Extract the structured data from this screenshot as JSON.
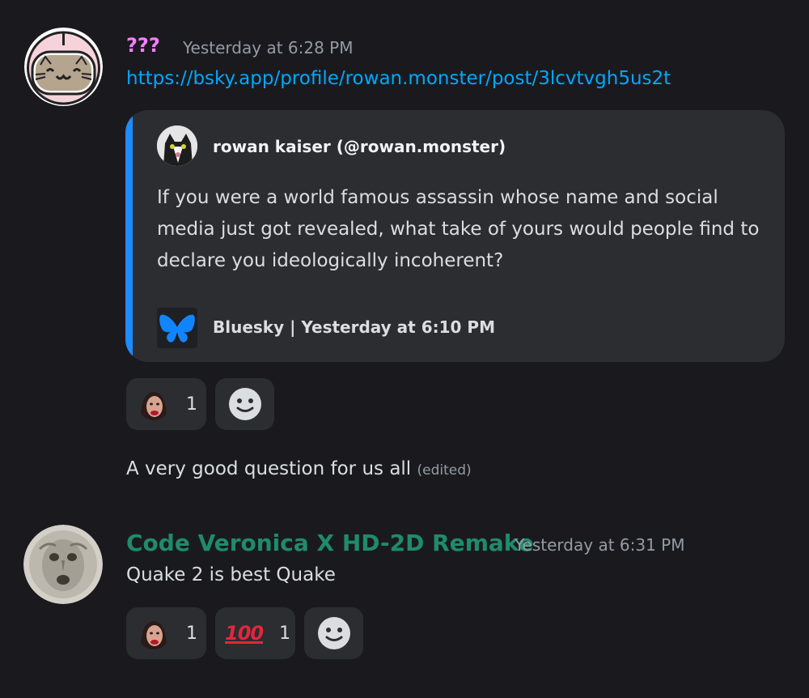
{
  "messages": [
    {
      "username": "???",
      "username_color": "#f47fff",
      "timestamp": "Yesterday at 6:28 PM",
      "avatar_icon": "cat-astronaut-avatar",
      "link": "https://bsky.app/profile/rowan.monster/post/3lcvtvgh5us2t",
      "embed": {
        "author": "rowan kaiser (@rowan.monster)",
        "description": "If you were a world famous assassin whose name and social media just got revealed, what take of yours would people find to declare you ideologically incoherent?",
        "footer": "Bluesky | Yesterday at 6:10 PM",
        "accent_color": "#1e8bff"
      },
      "reactions": [
        {
          "emoji": "face-emoji",
          "count": "1"
        }
      ],
      "followup_text": "A very good question for us all",
      "edited_label": "(edited)"
    },
    {
      "username": "Code Veronica X HD-2D Remake",
      "username_color": "#1f8b6c",
      "timestamp": "Yesterday at 6:31 PM",
      "avatar_icon": "stone-face-avatar",
      "text": "Quake 2 is best Quake",
      "reactions": [
        {
          "emoji": "face-emoji",
          "count": "1"
        },
        {
          "emoji": "hundred-points-emoji",
          "glyph": "100",
          "count": "1"
        }
      ]
    }
  ]
}
